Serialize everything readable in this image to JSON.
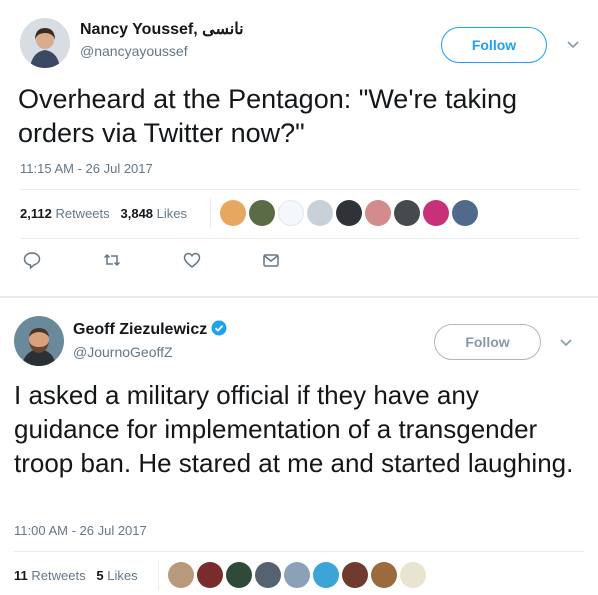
{
  "tweets": [
    {
      "name": "Nancy Youssef, نانسى",
      "handle": "@nancyayoussef",
      "follow_label": "Follow",
      "text": "Overheard at the Pentagon: \"We're taking orders via Twitter now?\"",
      "timestamp": "11:15 AM - 26 Jul 2017",
      "retweets_count": "2,112",
      "retweets_label": "Retweets",
      "likes_count": "3,848",
      "likes_label": "Likes"
    },
    {
      "name": "Geoff Ziezulewicz",
      "handle": "@JournoGeoffZ",
      "follow_label": "Follow",
      "text": "I asked a military official if they have any guidance for implementation of a transgender troop ban. He stared at me and started laughing.",
      "timestamp": "11:00 AM - 26 Jul 2017",
      "retweets_count": "11",
      "retweets_label": "Retweets",
      "likes_count": "5",
      "likes_label": "Likes"
    }
  ],
  "colors": {
    "accent": "#1da1f2",
    "secondary_text": "#657786",
    "divider": "#e6ecf0"
  },
  "icons": [
    "reply-icon",
    "retweet-icon",
    "like-icon",
    "direct-message-icon",
    "chevron-down-icon",
    "verified-badge-icon"
  ]
}
